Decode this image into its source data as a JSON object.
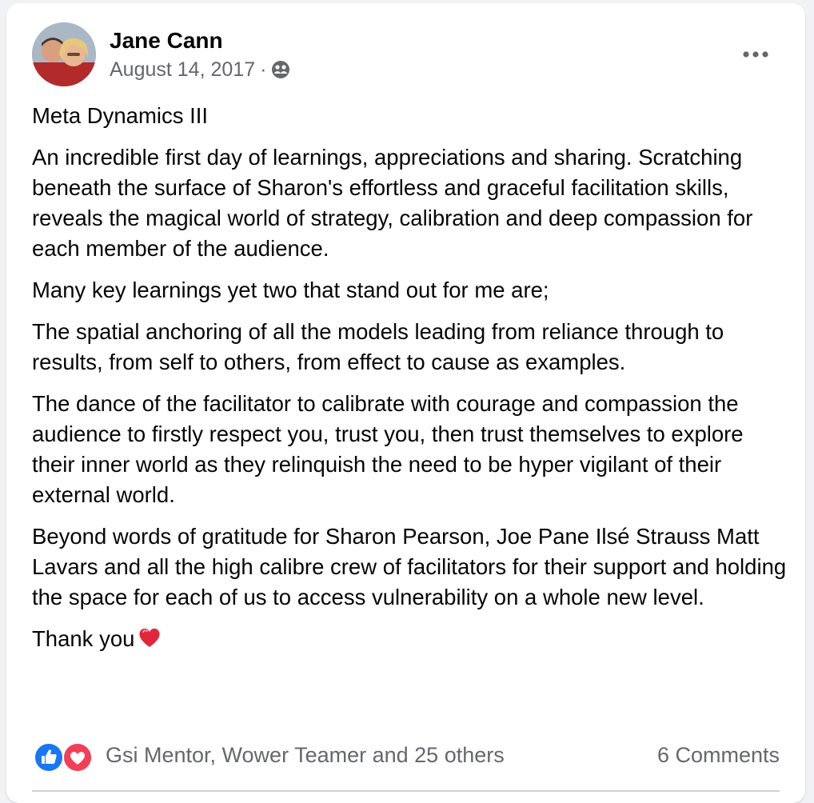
{
  "post": {
    "author": "Jane Cann",
    "date": "August 14, 2017",
    "separator": "·",
    "audience_icon": "friends-icon",
    "title": "Meta Dynamics III",
    "paragraphs": [
      "An incredible first day of learnings, appreciations and sharing. Scratching beneath the surface of Sharon's effortless and graceful facilitation skills, reveals the magical world of strategy, calibration and deep compassion for each member of the audience.",
      "Many key learnings yet two that stand out for me are;",
      "The spatial anchoring of all the models leading from reliance through to results, from self to others, from effect to cause as examples.",
      "The dance of the facilitator to calibrate with courage and compassion the audience to firstly respect you, trust you, then trust themselves to explore their inner world as they relinquish the need to be hyper vigilant of their external world.",
      "Beyond words of gratitude for Sharon Pearson, Joe Pane Ilsé Strauss Matt Lavars and all the high calibre crew of facilitators for their support and holding the space for each of us to access vulnerability on a whole new level."
    ],
    "closing": "Thank you"
  },
  "reactions": {
    "types": [
      "like",
      "love"
    ],
    "summary": "Gsi Mentor, Wower Teamer and 25 others"
  },
  "comments": {
    "label": "6 Comments"
  },
  "colors": {
    "like_blue": "#1877f2",
    "love_red": "#f33e58",
    "secondary_text": "#65676b",
    "primary_text": "#050505"
  }
}
